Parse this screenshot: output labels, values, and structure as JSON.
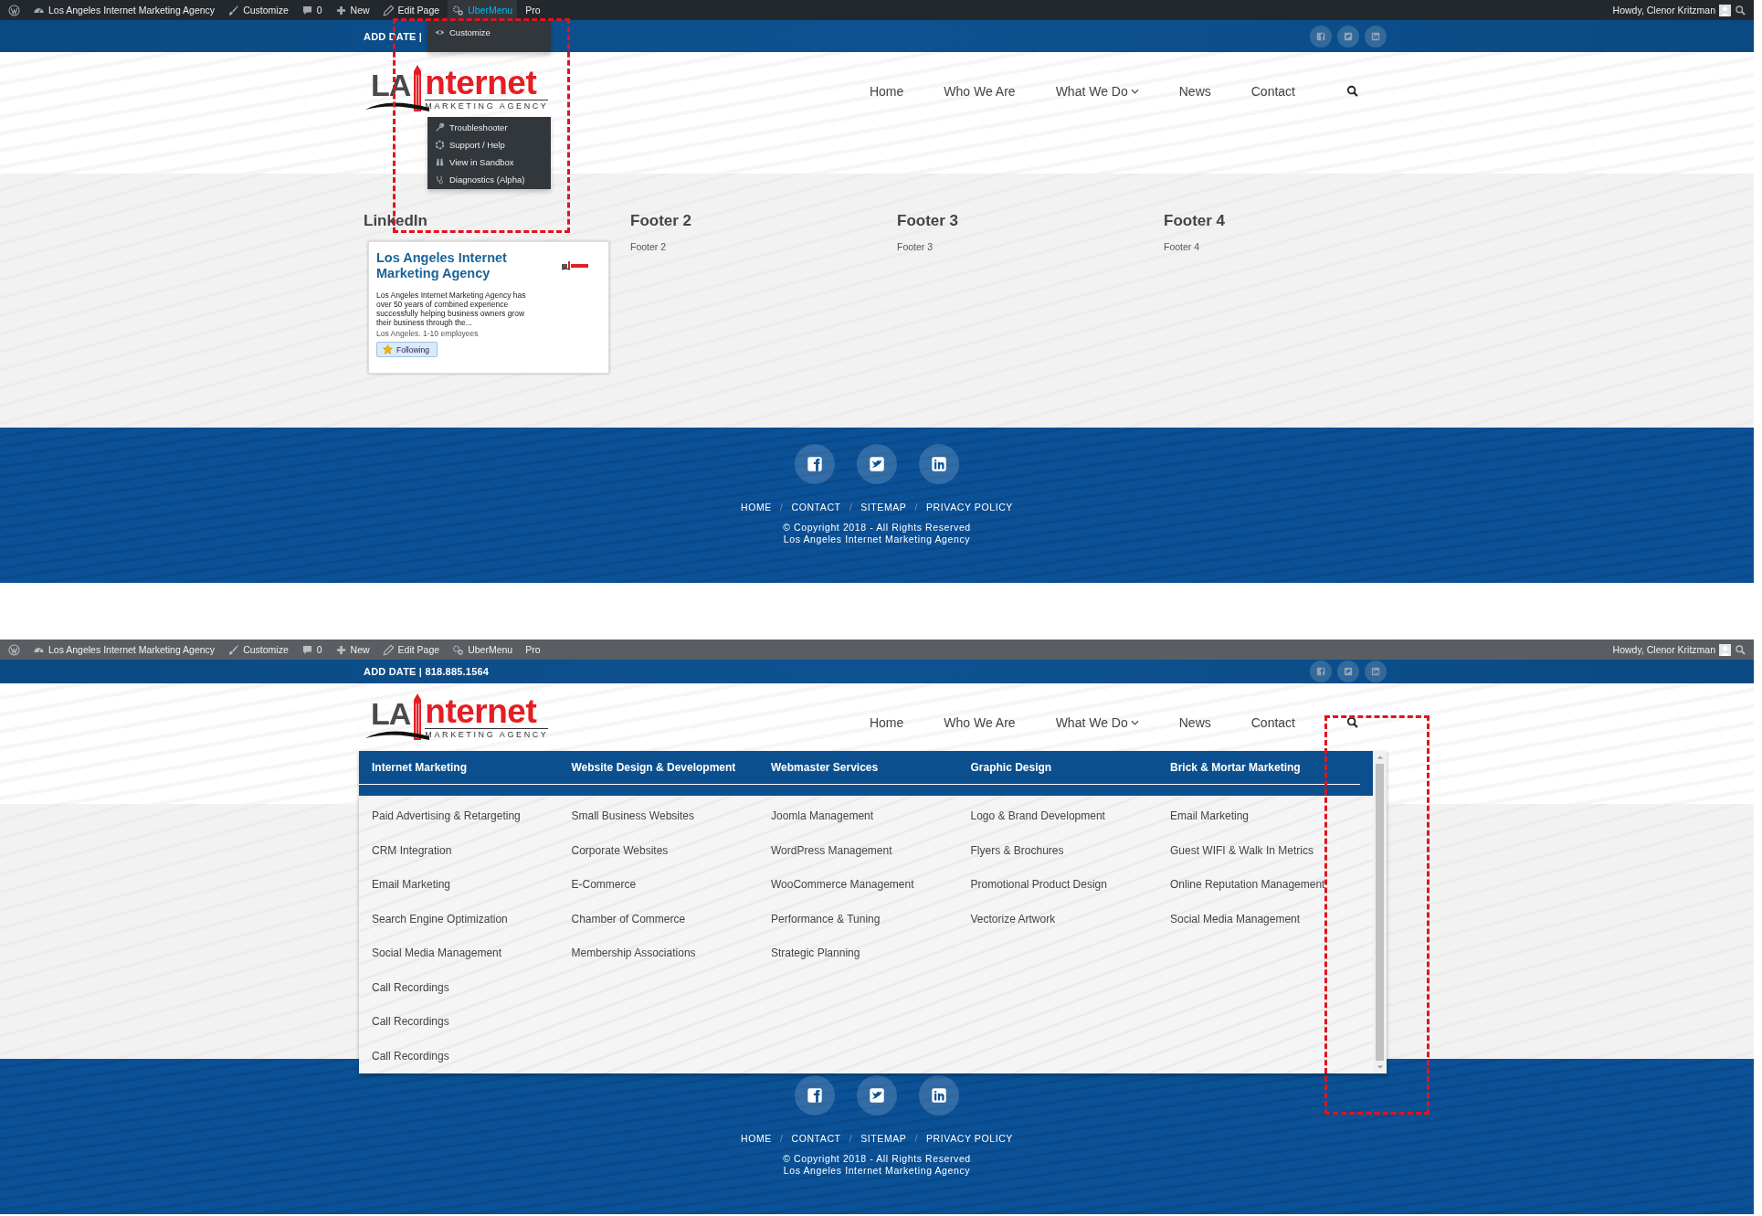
{
  "panels": [
    {
      "admin_bar": {
        "items": [
          {
            "kind": "wordpress",
            "selected": false
          },
          {
            "kind": "dashboard",
            "label": "Los Angeles Internet Marketing Agency",
            "selected": false
          },
          {
            "kind": "brush",
            "label": "Customize",
            "selected": false
          },
          {
            "kind": "comment",
            "label": "0",
            "selected": false
          },
          {
            "kind": "plus",
            "label": "New",
            "selected": false
          },
          {
            "kind": "pencil",
            "label": "Edit Page",
            "selected": false
          },
          {
            "kind": "gears",
            "label": "UberMenu",
            "selected": true
          },
          {
            "kind": "plain",
            "label": "Pro",
            "selected": false
          }
        ],
        "greeting": "Howdy, Clenor Kritzman"
      },
      "top_bar": {
        "text": "ADD DATE |"
      },
      "logo": {
        "lead": "LA",
        "main": "nternet",
        "tagline": "MARKETING AGENCY"
      },
      "nav": [
        {
          "label": "Home",
          "has_submenu": false
        },
        {
          "label": "Who We Are",
          "has_submenu": false
        },
        {
          "label": "What We Do",
          "has_submenu": true
        },
        {
          "label": "News",
          "has_submenu": false
        },
        {
          "label": "Contact",
          "has_submenu": false
        }
      ],
      "admin_dropdown": {
        "top_items": [
          {
            "kind": "eye",
            "label": "Customize"
          }
        ],
        "bottom_items": [
          {
            "kind": "wrench",
            "label": "Troubleshooter"
          },
          {
            "kind": "lifebuoy",
            "label": "Support / Help"
          },
          {
            "kind": "binoculars",
            "label": "View in Sandbox"
          },
          {
            "kind": "stethoscope",
            "label": "Diagnostics (Alpha)"
          }
        ]
      },
      "widgets": [
        {
          "kind": "linkedin",
          "title": "LinkedIn",
          "card": {
            "name": "Los Angeles Internet Marketing Agency",
            "description": "Los Angeles Internet Marketing Agency has over 50 years of combined experience successfully helping business owners grow their business through the...",
            "meta": "Los Angeles. 1-10 employees",
            "button": "Following"
          }
        },
        {
          "kind": "text",
          "title": "Footer 2",
          "text": "Footer 2"
        },
        {
          "kind": "text",
          "title": "Footer 3",
          "text": "Footer 3"
        },
        {
          "kind": "text",
          "title": "Footer 4",
          "text": "Footer 4"
        }
      ],
      "footer": {
        "links": [
          "HOME",
          "CONTACT",
          "SITEMAP",
          "PRIVACY POLICY"
        ],
        "separator": "/",
        "copyright": [
          "© Copyright 2018 - All Rights Reserved",
          "Los Angeles Internet Marketing Agency"
        ]
      },
      "annotation": {
        "kind": "around_dropdown"
      }
    },
    {
      "admin_bar": {
        "items": [
          {
            "kind": "wordpress",
            "selected": false
          },
          {
            "kind": "dashboard",
            "label": "Los Angeles Internet Marketing Agency",
            "selected": false
          },
          {
            "kind": "brush",
            "label": "Customize",
            "selected": false
          },
          {
            "kind": "comment",
            "label": "0",
            "selected": false
          },
          {
            "kind": "plus",
            "label": "New",
            "selected": false
          },
          {
            "kind": "pencil",
            "label": "Edit Page",
            "selected": false
          },
          {
            "kind": "gears",
            "label": "UberMenu",
            "selected": false
          },
          {
            "kind": "plain",
            "label": "Pro",
            "selected": false
          }
        ],
        "greeting": "Howdy, Clenor Kritzman"
      },
      "top_bar": {
        "text": "ADD DATE | 818.885.1564"
      },
      "logo": {
        "lead": "LA",
        "main": "nternet",
        "tagline": "MARKETING AGENCY"
      },
      "nav": [
        {
          "label": "Home",
          "has_submenu": false
        },
        {
          "label": "Who We Are",
          "has_submenu": false
        },
        {
          "label": "What We Do",
          "has_submenu": true
        },
        {
          "label": "News",
          "has_submenu": false
        },
        {
          "label": "Contact",
          "has_submenu": false
        }
      ],
      "mega_menu": {
        "columns": [
          {
            "heading": "Internet Marketing",
            "items": [
              "Paid Advertising & Retargeting",
              "CRM Integration",
              "Email Marketing",
              "Search Engine Optimization",
              "Social Media Management",
              "Call Recordings",
              "Call Recordings",
              "Call Recordings"
            ]
          },
          {
            "heading": "Website Design & Development",
            "items": [
              "Small Business Websites",
              "Corporate Websites",
              "E-Commerce",
              "Chamber of Commerce",
              "Membership Associations"
            ]
          },
          {
            "heading": "Webmaster Services",
            "items": [
              "Joomla Management",
              "WordPress Management",
              "WooCommerce Management",
              "Performance & Tuning",
              "Strategic Planning"
            ]
          },
          {
            "heading": "Graphic Design",
            "items": [
              "Logo & Brand Development",
              "Flyers & Brochures",
              "Promotional Product Design",
              "Vectorize Artwork"
            ]
          },
          {
            "heading": "Brick & Mortar Marketing",
            "items": [
              "Email Marketing",
              "Guest WIFI & Walk In Metrics",
              "Online Reputation Management",
              "Social Media Management"
            ]
          }
        ]
      },
      "footer": {
        "links": [
          "HOME",
          "CONTACT",
          "SITEMAP",
          "PRIVACY POLICY"
        ],
        "separator": "/",
        "copyright": [
          "© Copyright 2018 - All Rights Reserved",
          "Los Angeles Internet Marketing Agency"
        ]
      },
      "annotation": {
        "kind": "around_search"
      }
    }
  ]
}
